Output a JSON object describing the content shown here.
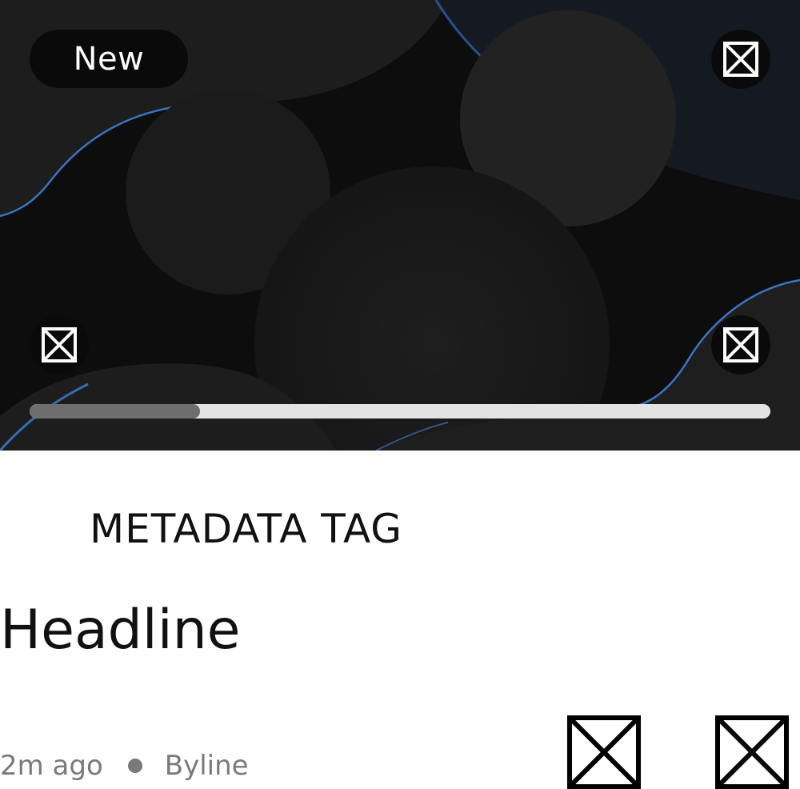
{
  "hero": {
    "badge_label": "New",
    "icons": {
      "top_right": "broken-image-icon",
      "bottom_left": "broken-image-icon",
      "bottom_right": "broken-image-icon"
    },
    "progress": 0.23,
    "colors": {
      "background": "#0d0d0d",
      "shape": "#1c1c1c",
      "accent": "#3d7fd6",
      "progress_fill": "#6e6e6e",
      "progress_track": "#e3e3e3"
    }
  },
  "card": {
    "metadata_tag": "METADATA TAG",
    "headline": "Headline",
    "timestamp": "2m ago",
    "byline": "Byline",
    "actions": [
      {
        "icon": "broken-image-icon"
      },
      {
        "icon": "broken-image-icon"
      }
    ]
  }
}
